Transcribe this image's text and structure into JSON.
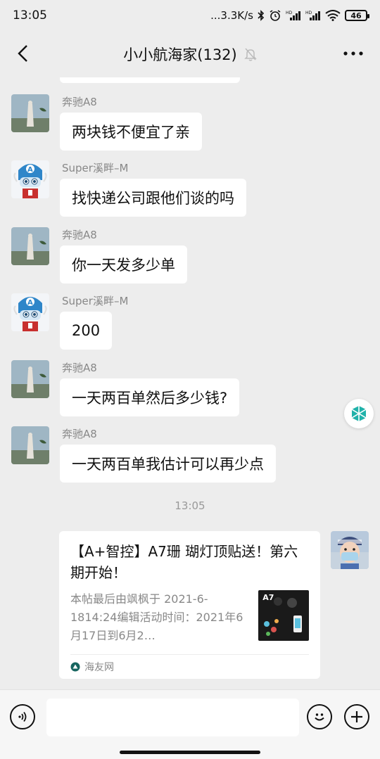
{
  "status_bar": {
    "time": "13:05",
    "net_speed": "...3.3K/s",
    "battery": "46"
  },
  "header": {
    "title": "小小航海家(132)"
  },
  "messages": [
    {
      "sender": "奔驰A8",
      "text": "两块钱不便宜了亲"
    },
    {
      "sender": "Super溪畔–M",
      "text": "找快递公司跟他们谈的吗"
    },
    {
      "sender": "奔驰A8",
      "text": "你一天发多少单"
    },
    {
      "sender": "Super溪畔–M",
      "text": "200"
    },
    {
      "sender": "奔驰A8",
      "text": "一天两百单然后多少钱?"
    },
    {
      "sender": "奔驰A8",
      "text": "一天两百单我估计可以再少点"
    }
  ],
  "time_divider": "13:05",
  "link_card": {
    "title": "【A+智控】A7珊 瑚灯顶贴送！第六期开始！",
    "description": "本帖最后由飒枫于 2021-6-1814:24编辑活动时间：2021年6月17日到6月2…",
    "thumb_label": "A7",
    "source": "海友网"
  },
  "colors": {
    "background": "#ededed",
    "bubble": "#ffffff",
    "accent_green": "#07c160"
  }
}
